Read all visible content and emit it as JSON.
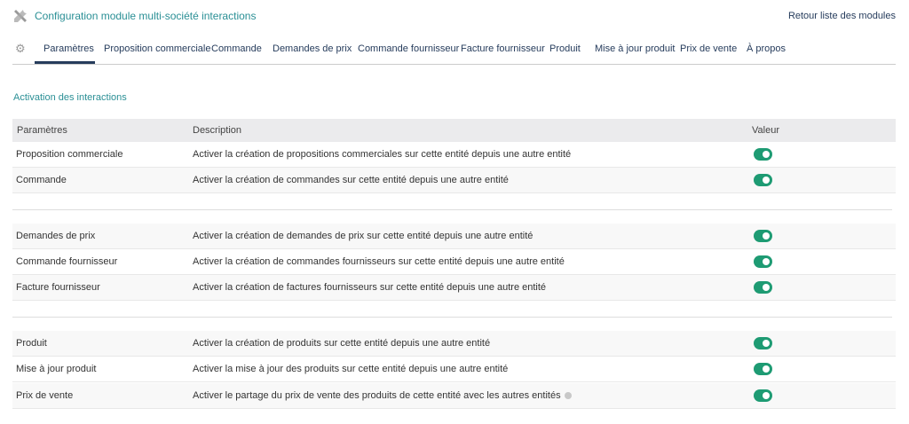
{
  "header": {
    "title": "Configuration module multi-société interactions",
    "back_link": "Retour liste des modules"
  },
  "tabs": [
    "Paramètres",
    "Proposition commerciale",
    "Commande",
    "Demandes de prix",
    "Commande fournisseur",
    "Facture fournisseur",
    "Produit",
    "Mise à jour produit",
    "Prix de vente",
    "À propos"
  ],
  "section_title": "Activation des interactions",
  "table": {
    "columns": [
      "Paramètres",
      "Description",
      "Valeur"
    ],
    "rows": [
      {
        "param": "Proposition commerciale",
        "desc": "Activer la création de propositions commerciales sur cette entité depuis une autre entité",
        "enabled": true
      },
      {
        "param": "Commande",
        "desc": "Activer la création de commandes sur cette entité depuis une autre entité",
        "enabled": true
      },
      {
        "param": "Demandes de prix",
        "desc": "Activer la création de demandes de prix sur cette entité depuis une autre entité",
        "enabled": true
      },
      {
        "param": "Commande fournisseur",
        "desc": "Activer la création de commandes fournisseurs sur cette entité depuis une autre entité",
        "enabled": true
      },
      {
        "param": "Facture fournisseur",
        "desc": "Activer la création de factures fournisseurs sur cette entité depuis une autre entité",
        "enabled": true
      },
      {
        "param": "Produit",
        "desc": "Activer la création de produits sur cette entité depuis une autre entité",
        "enabled": true
      },
      {
        "param": "Mise à jour produit",
        "desc": "Activer la mise à jour des produits sur cette entité depuis une autre entité",
        "enabled": true
      },
      {
        "param": "Prix de vente",
        "desc": "Activer le partage du prix de vente des produits de cette entité avec les autres entités",
        "enabled": true
      }
    ]
  },
  "colors": {
    "accent": "#2a8f95",
    "nav": "#263c5c",
    "toggle_on": "#1e9b73"
  }
}
